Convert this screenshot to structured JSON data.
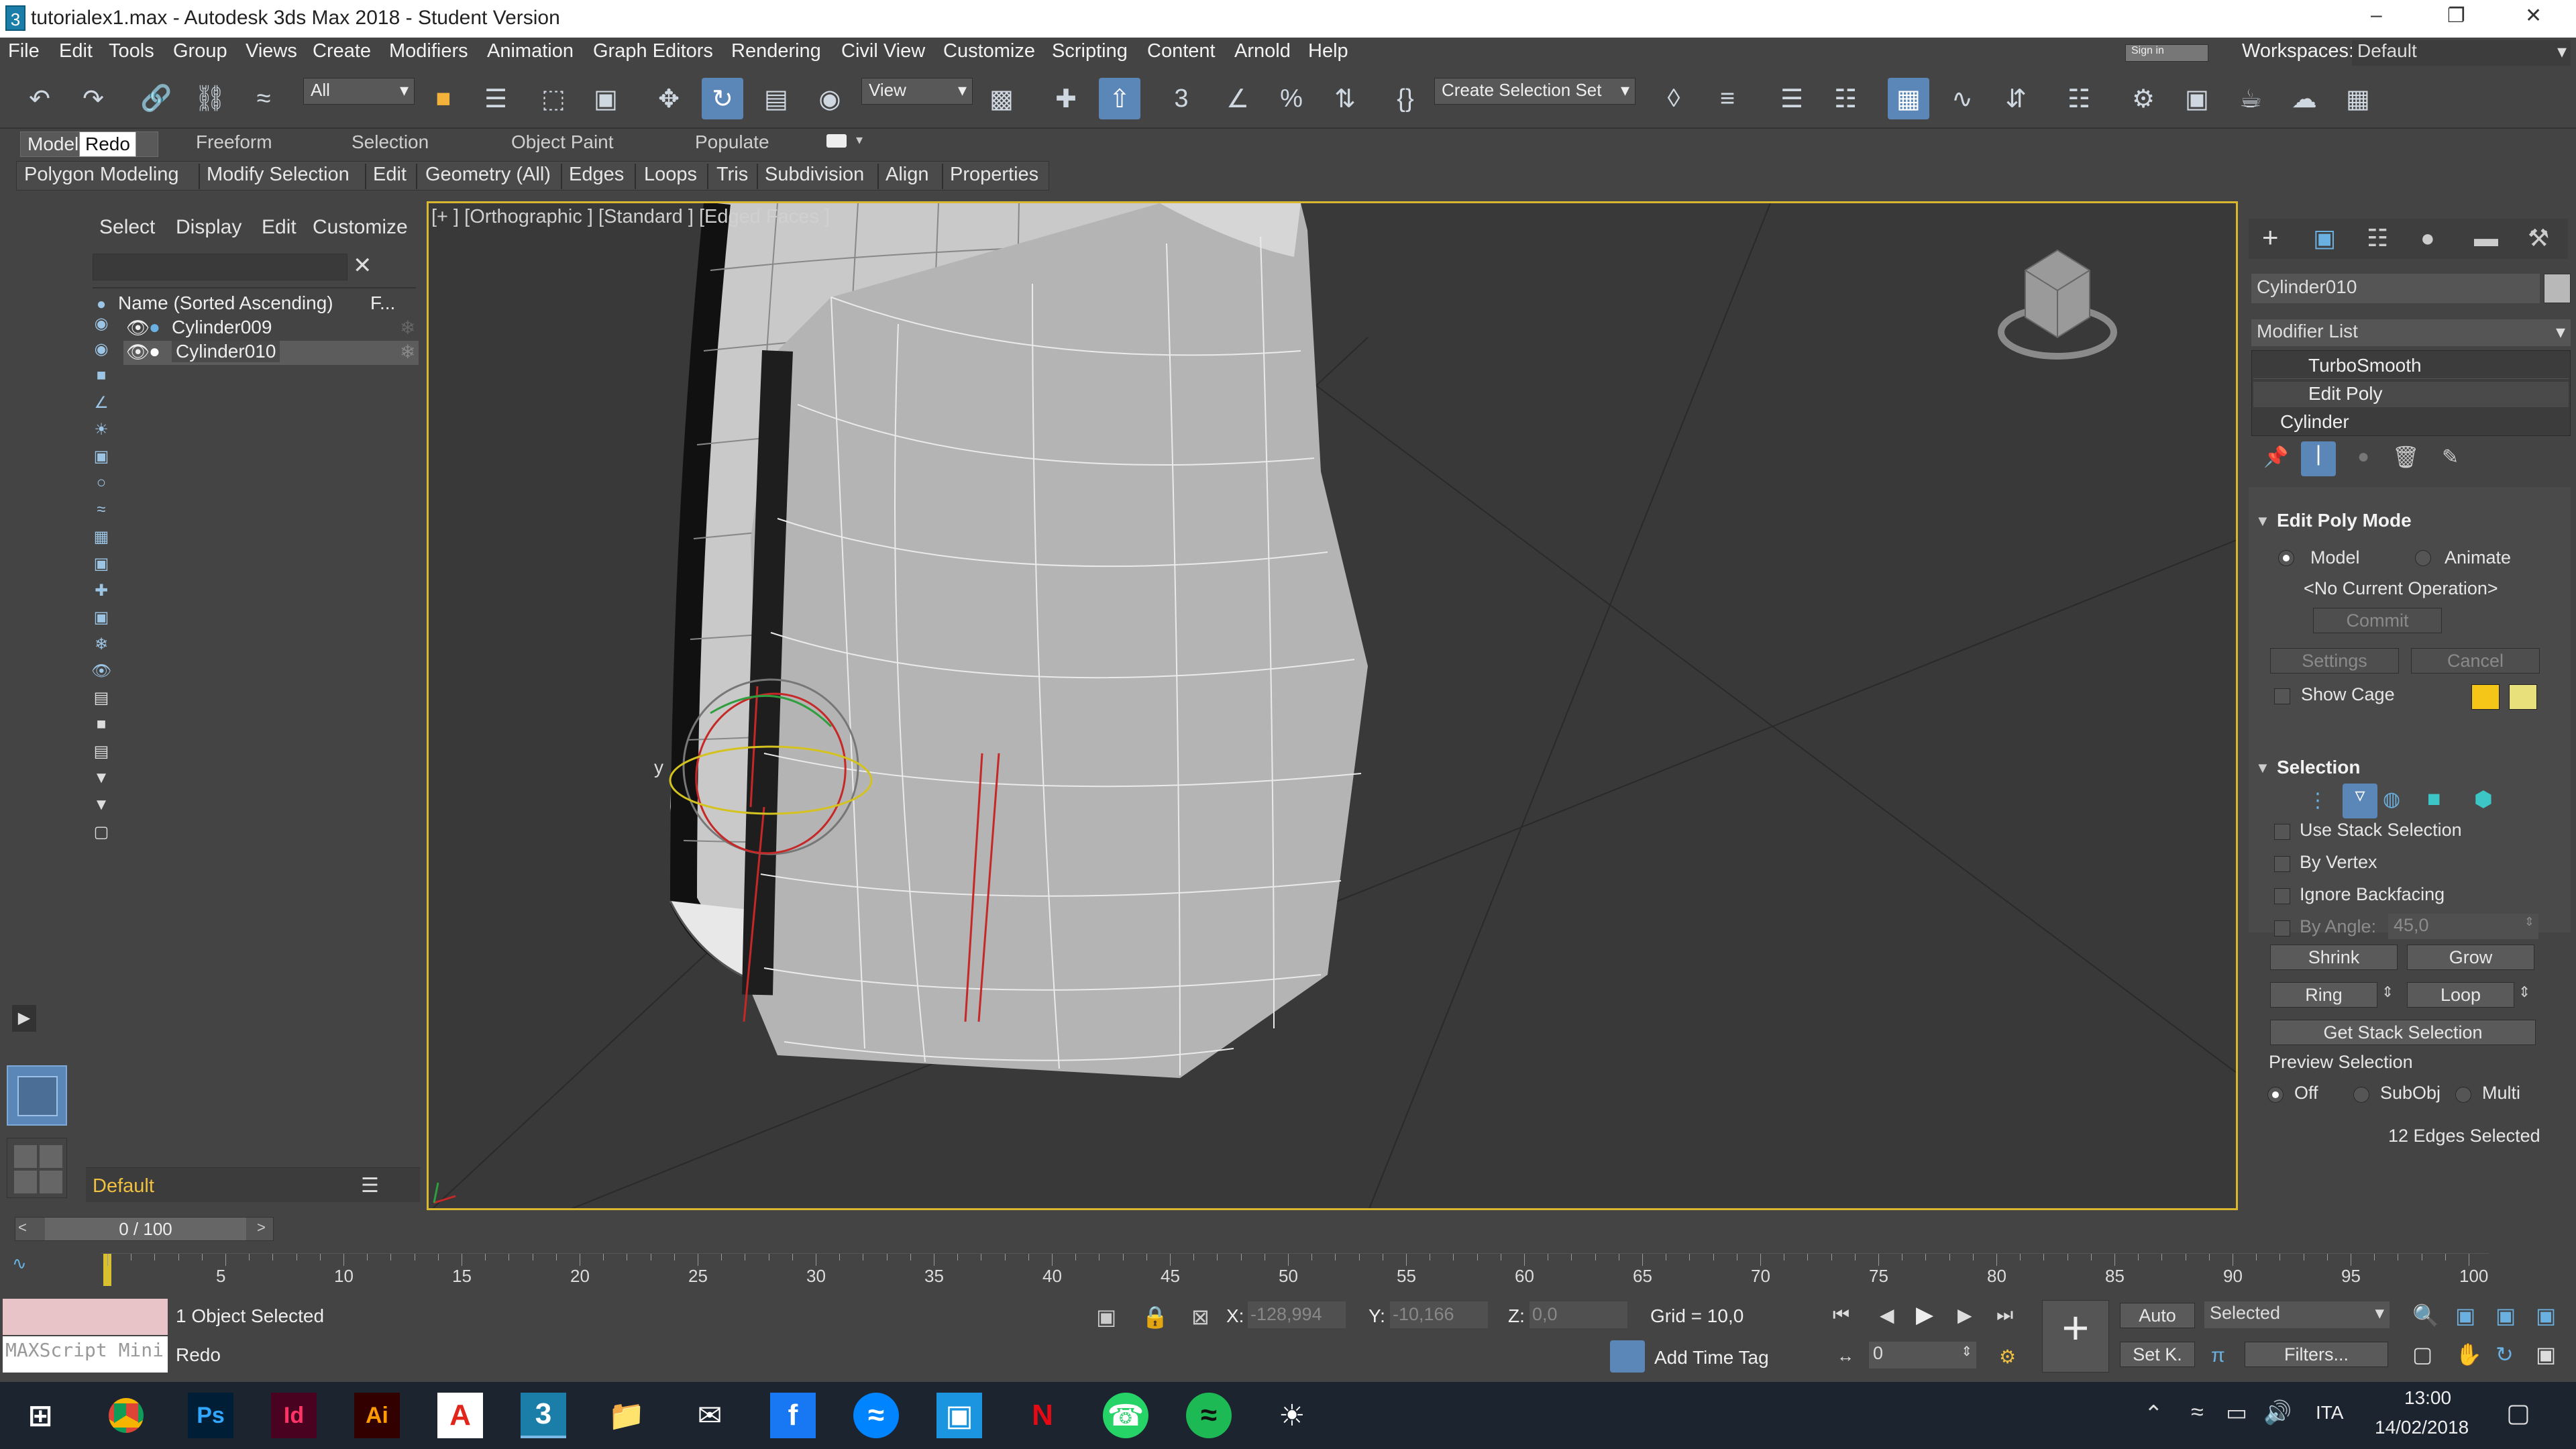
{
  "window": {
    "title": "tutorialex1.max - Autodesk 3ds Max 2018 - Student Version",
    "app_icon": "3"
  },
  "menu": [
    "File",
    "Edit",
    "Tools",
    "Group",
    "Views",
    "Create",
    "Modifiers",
    "Animation",
    "Graph Editors",
    "Rendering",
    "Civil View",
    "Customize",
    "Scripting",
    "Content",
    "Arnold",
    "Help"
  ],
  "topright": {
    "signin": "Sign in",
    "workspaces_label": "Workspaces:",
    "workspace_value": "Default"
  },
  "toolbar": {
    "filter_value": "All",
    "refcoord_value": "View",
    "selection_set": "Create Selection Set"
  },
  "ribbon": {
    "tabs": [
      "Modeling",
      "Freeform",
      "Selection",
      "Object Paint",
      "Populate"
    ],
    "tooltip": "Redo",
    "subtabs": [
      "Polygon Modeling",
      "Modify Selection",
      "Edit",
      "Geometry (All)",
      "Edges",
      "Loops",
      "Tris",
      "Subdivision",
      "Align",
      "Properties"
    ]
  },
  "scene_explorer": {
    "tabs": [
      "Select",
      "Display",
      "Edit",
      "Customize"
    ],
    "column_name": "Name (Sorted Ascending)",
    "column_f": "F...",
    "rows": [
      "Cylinder009",
      "Cylinder010"
    ],
    "layer": "Default"
  },
  "viewport": {
    "label": "[+ ] [Orthographic ] [Standard ] [Edged Faces ]",
    "gizmo_axis": "y"
  },
  "command_panel": {
    "object_name": "Cylinder010",
    "object_color": "#b8b8b8",
    "modifier_list": "Modifier List",
    "stack": [
      "TurboSmooth",
      "Edit Poly",
      "Cylinder"
    ],
    "edit_poly_mode": {
      "title": "Edit Poly Mode",
      "model": "Model",
      "animate": "Animate",
      "current_op": "<No Current Operation>",
      "commit": "Commit",
      "settings": "Settings",
      "cancel": "Cancel",
      "show_cage": "Show Cage",
      "cage_color1": "#f5c518",
      "cage_color2": "#e8e07a"
    },
    "selection": {
      "title": "Selection",
      "use_stack": "Use Stack Selection",
      "by_vertex": "By Vertex",
      "ignore_backfacing": "Ignore Backfacing",
      "by_angle": "By Angle:",
      "angle_value": "45,0",
      "shrink": "Shrink",
      "grow": "Grow",
      "ring": "Ring",
      "loop": "Loop",
      "get_stack": "Get Stack Selection",
      "preview": "Preview Selection",
      "off": "Off",
      "subobj": "SubObj",
      "multi": "Multi",
      "status": "12 Edges Selected"
    }
  },
  "timeline": {
    "frame_display": "0 / 100",
    "ticks": [
      "5",
      "10",
      "15",
      "20",
      "25",
      "30",
      "35",
      "40",
      "45",
      "50",
      "55",
      "60",
      "65",
      "70",
      "75",
      "80",
      "85",
      "90",
      "95",
      "100"
    ]
  },
  "statusbar": {
    "maxscript": "MAXScript Mini",
    "objects_selected": "1 Object Selected",
    "last_action": "Redo",
    "x_label": "X:",
    "x_value": "-128,994",
    "y_label": "Y:",
    "y_value": "-10,166",
    "z_label": "Z:",
    "z_value": "0,0",
    "grid": "Grid = 10,0",
    "add_time_tag": "Add Time Tag",
    "auto": "Auto",
    "set_key": "Set K.",
    "selected_dropdown": "Selected",
    "filters": "Filters...",
    "frame_value": "0"
  },
  "taskbar": {
    "apps": [
      "Chrome",
      "Ps",
      "Id",
      "Ai",
      "Acrobat",
      "3ds Max",
      "Explorer",
      "Mail",
      "Facebook",
      "Messenger",
      "Instagram",
      "Netflix",
      "WhatsApp",
      "Spotify",
      "Brightness"
    ],
    "language": "ITA",
    "time": "13:00",
    "date": "14/02/2018"
  }
}
